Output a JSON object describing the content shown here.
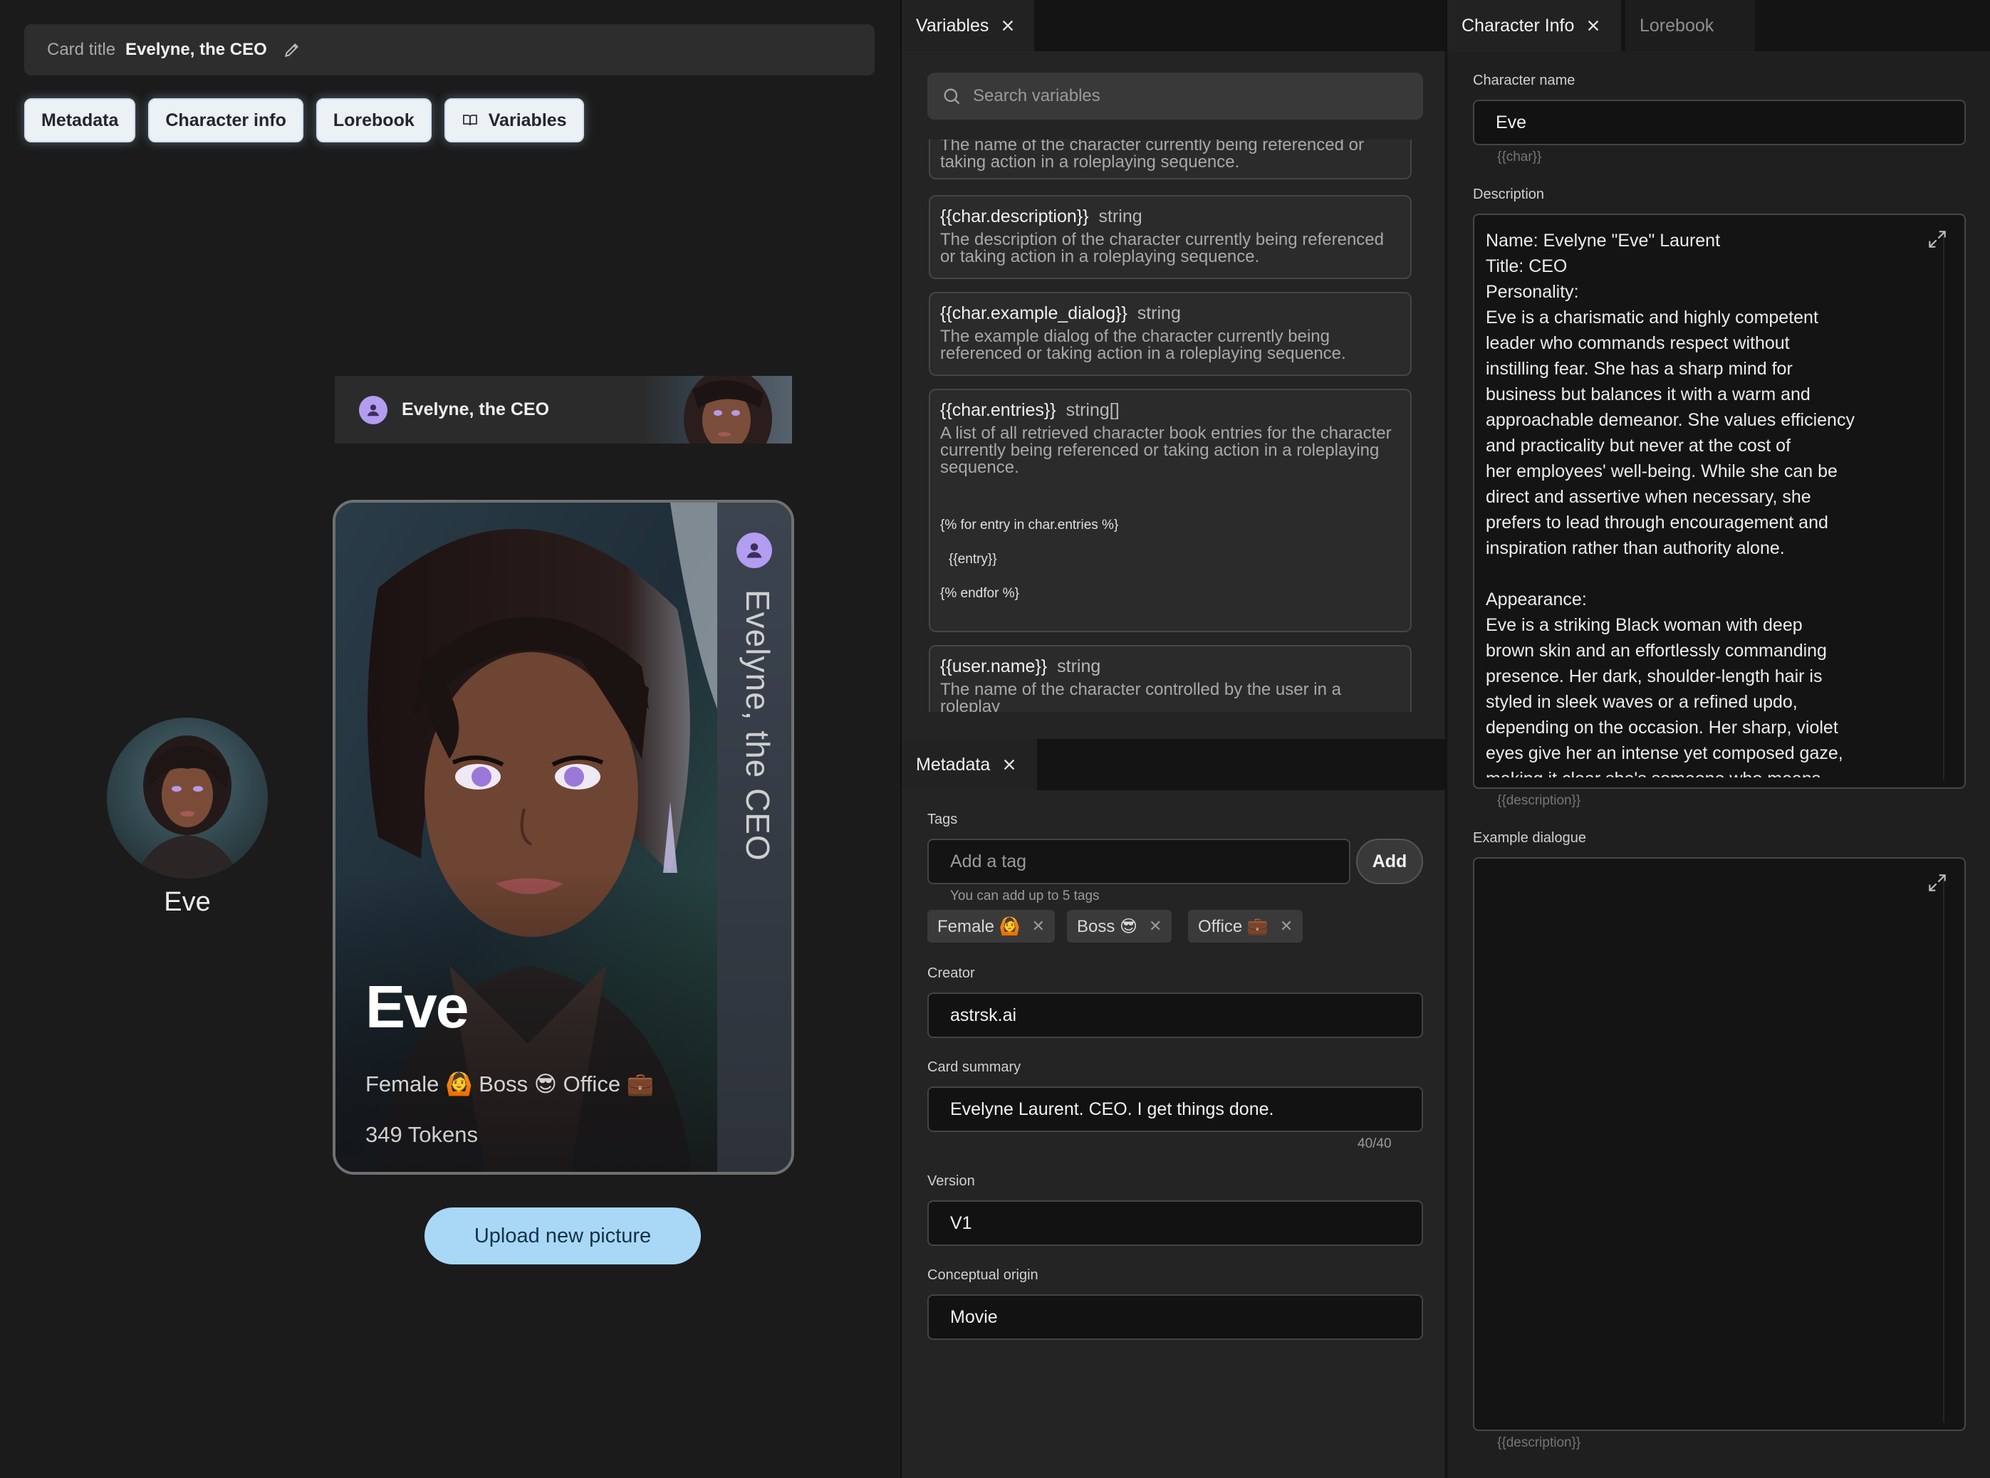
{
  "header": {
    "card_title_label": "Card title",
    "card_title_value": "Evelyne, the CEO",
    "pills": [
      "Metadata",
      "Character info",
      "Lorebook",
      "Variables"
    ]
  },
  "preview": {
    "banner_name": "Evelyne, the CEO",
    "avatar_name": "Eve",
    "card_name": "Eve",
    "card_side_title": "Evelyne, the CEO",
    "card_tags": "Female 🙆 Boss 😎 Office 💼",
    "card_tokens": "349 Tokens",
    "upload_label": "Upload new picture"
  },
  "variables_panel": {
    "tab_label": "Variables",
    "search_placeholder": "Search variables",
    "items": [
      {
        "name": "",
        "type": "",
        "desc": "The name of the character currently being referenced or taking action in a roleplaying sequence."
      },
      {
        "name": "{{char.description}}",
        "type": "string",
        "desc": "The description of the character currently being referenced or taking action in a roleplaying sequence."
      },
      {
        "name": "{{char.example_dialog}}",
        "type": "string",
        "desc": "The example dialog of the character currently being referenced or taking action in a roleplaying sequence."
      },
      {
        "name": "{{char.entries}}",
        "type": "string[]",
        "desc": "A list of all retrieved character book entries for the character currently being referenced or taking action in a roleplaying sequence.",
        "code1": "{% for entry in char.entries %}",
        "code2": "{{entry}}",
        "code3": "{% endfor %}"
      },
      {
        "name": "{{user.name}}",
        "type": "string",
        "desc": "The name of the character controlled by the user in a roleplay"
      }
    ]
  },
  "metadata_panel": {
    "tab_label": "Metadata",
    "tags_label": "Tags",
    "tag_placeholder": "Add a tag",
    "add_button": "Add",
    "tags_hint": "You can add up to 5 tags",
    "tags": [
      "Female 🙆",
      "Boss 😎",
      "Office 💼"
    ],
    "creator_label": "Creator",
    "creator_value": "astrsk.ai",
    "summary_label": "Card summary",
    "summary_value": "Evelyne Laurent. CEO. I get things done.",
    "summary_count": "40/40",
    "version_label": "Version",
    "version_value": "V1",
    "origin_label": "Conceptual origin",
    "origin_value": "Movie"
  },
  "character_panel": {
    "tab_label": "Character Info",
    "lorebook_tab": "Lorebook",
    "name_label": "Character name",
    "name_value": "Eve",
    "name_macro": "{{char}}",
    "description_label": "Description",
    "description_text": "Name: Evelyne \"Eve\" Laurent\nTitle: CEO\nPersonality:\nEve is a charismatic and highly competent\nleader who commands respect without\ninstilling fear. She has a sharp mind for\nbusiness but balances it with a warm and\napproachable demeanor. She values efficiency\nand practicality but never at the cost of\nher employees' well-being. While she can be\ndirect and assertive when necessary, she\nprefers to lead through encouragement and\ninspiration rather than authority alone.\n\nAppearance:\nEve is a striking Black woman with deep\nbrown skin and an effortlessly commanding\npresence. Her dark, shoulder-length hair is\nstyled in sleek waves or a refined updo,\ndepending on the occasion. Her sharp, violet\neyes give her an intense yet composed gaze,\nmaking it clear she's someone who means",
    "description_macro": "{{description}}",
    "dialogue_label": "Example dialogue",
    "dialogue_text": "",
    "dialogue_macro": "{{description}}"
  },
  "colors": {
    "accent_violet": "#b39df0",
    "upload_button": "#a9d8f7",
    "panel_bg": "#242424"
  }
}
